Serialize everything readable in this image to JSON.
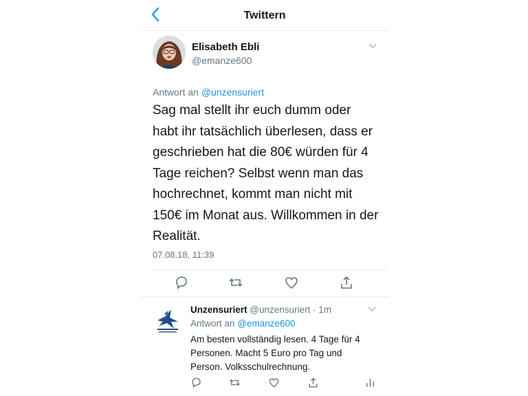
{
  "nav": {
    "back_icon": "chevron-left-icon",
    "title": "Twittern"
  },
  "tweet": {
    "author_name": "Elisabeth Ebli",
    "author_handle": "@emanze600",
    "reply_prefix": "Antwort an",
    "reply_mention": "@unzensuriert",
    "text": "Sag mal stellt ihr euch dumm oder habt ihr tatsächlich überlesen, dass er geschrieben hat die 80€ würden für 4 Tage reichen? Selbst wenn man das hochrechnet, kommt man nicht mit 150€ im Monat aus. Willkommen in der Realität.",
    "timestamp": "07.08.18, 11:39",
    "actions": [
      "reply-icon",
      "retweet-icon",
      "like-icon",
      "share-icon"
    ]
  },
  "reply": {
    "author_name": "Unzensuriert",
    "author_handle": "@unzensuriert",
    "separator": " · ",
    "age": "1m",
    "reply_prefix": "Antwort an",
    "reply_mention": "@emanze600",
    "text": "Am besten vollständig lesen. 4 Tage für 4 Personen. Macht 5 Euro pro Tag und Person. Volksschulrechnung.",
    "actions": [
      "reply-icon",
      "retweet-icon",
      "like-icon",
      "share-icon",
      "analytics-icon"
    ]
  },
  "colors": {
    "accent": "#1da1f2",
    "mention": "#1b95e0",
    "secondary_text": "#657786",
    "divider": "#e6ecf0"
  }
}
